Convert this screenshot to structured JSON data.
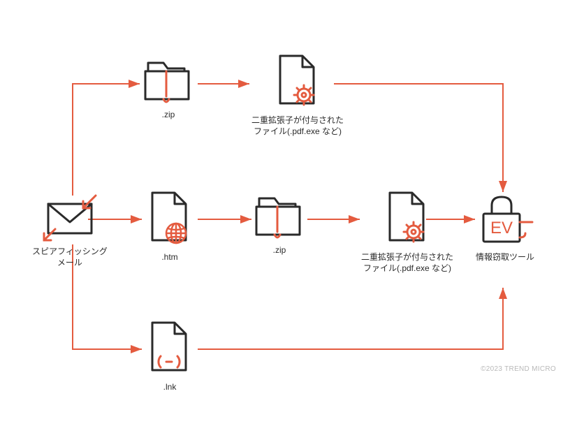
{
  "nodes": {
    "mail": {
      "label": "スピアフィッシング\nメール"
    },
    "zipTop": {
      "label": ".zip"
    },
    "dblExtTop": {
      "label": "二重拡張子が付与された\nファイル(.pdf.exe など)"
    },
    "htm": {
      "label": ".htm"
    },
    "zipMid": {
      "label": ".zip"
    },
    "dblExtMid": {
      "label": "二重拡張子が付与された\nファイル(.pdf.exe など)"
    },
    "stealer": {
      "label": "情報窃取ツール"
    },
    "lnk": {
      "label": ".lnk"
    }
  },
  "ev_text": "EV",
  "copyright": "©2023 TREND MICRO",
  "colors": {
    "accent": "#e45b3f",
    "line": "#2a2a2a"
  }
}
